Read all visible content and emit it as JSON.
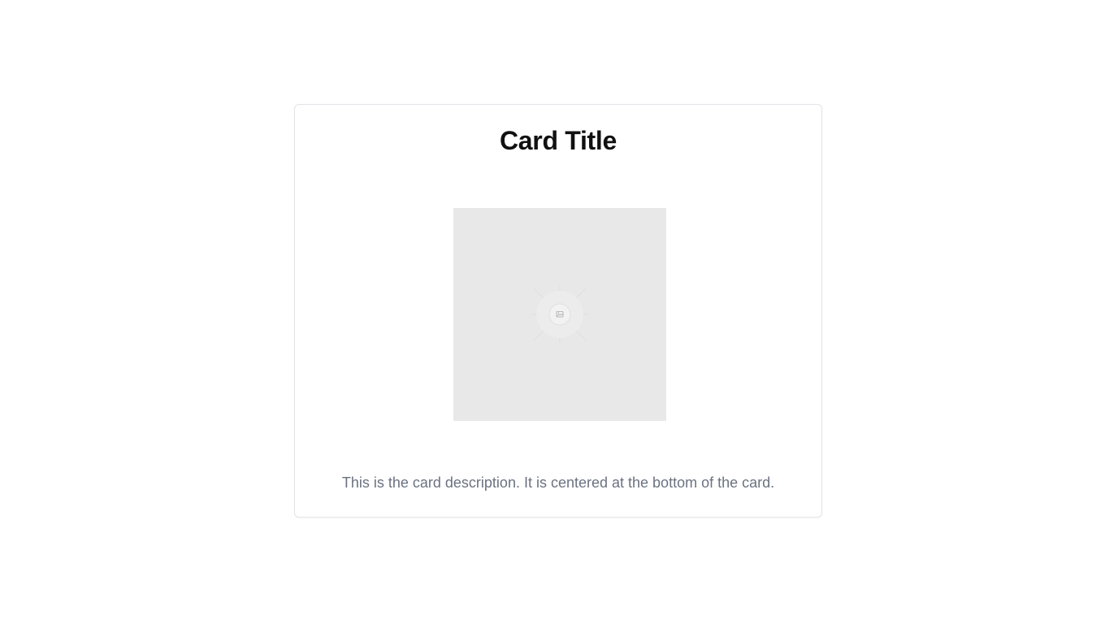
{
  "card": {
    "title": "Card Title",
    "image": {
      "icon": "image-icon"
    },
    "description": "This is the card description. It is centered at the bottom of the card."
  }
}
